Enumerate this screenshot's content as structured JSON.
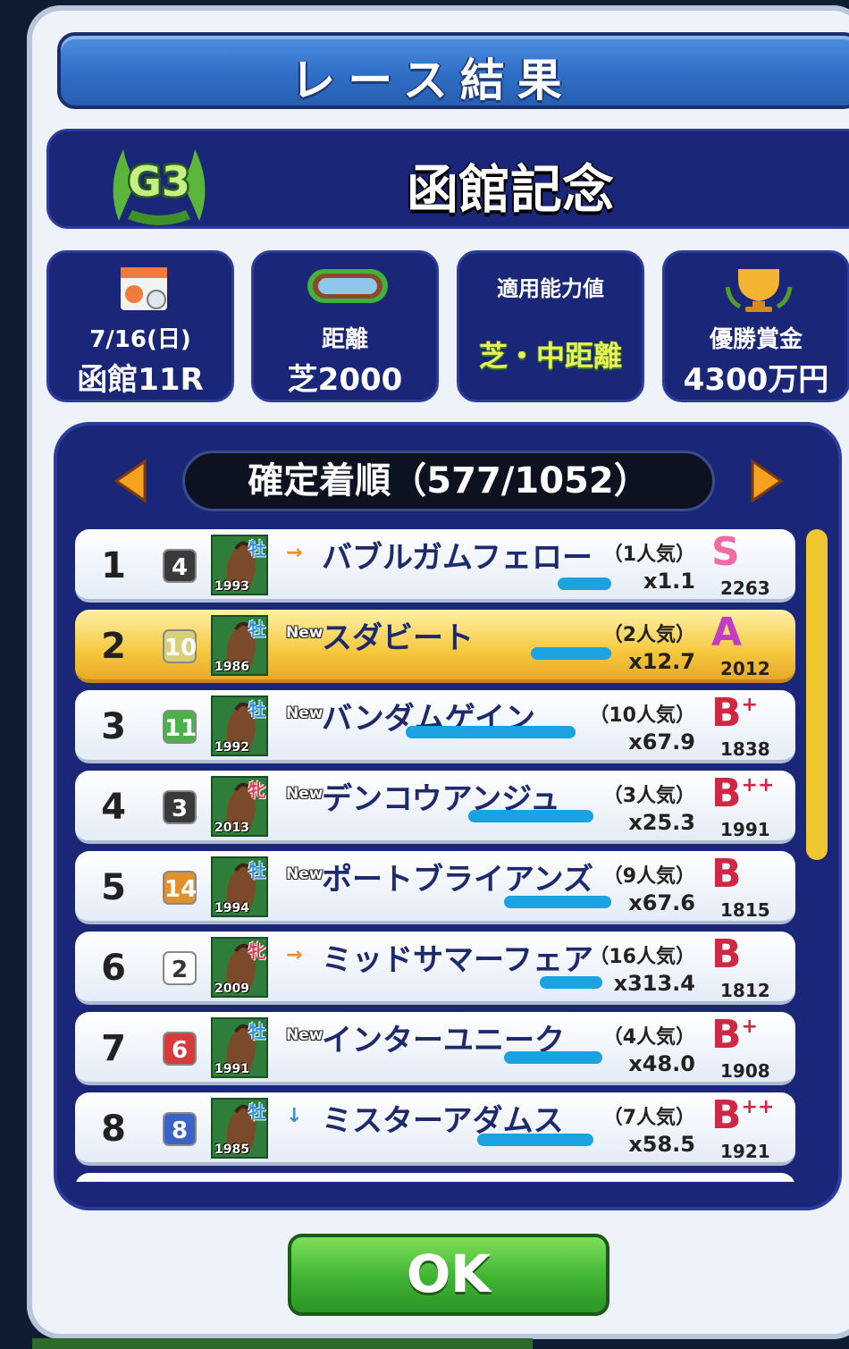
{
  "header": {
    "title": "レース結果"
  },
  "race": {
    "grade": "G3",
    "name": "函館記念"
  },
  "info": {
    "date": "7/16(日)",
    "venue_race": "函館11R",
    "distance_label": "距離",
    "distance_value": "芝2000",
    "ability_label": "適用能力値",
    "ability_value": "芝・中距離",
    "prize_label": "優勝賞金",
    "prize_value": "4300万円"
  },
  "results": {
    "header": "確定着順（577/1052）",
    "rows": [
      {
        "place": "1",
        "gate": "4",
        "sex": "牡",
        "year": "1993",
        "trend": "→",
        "name": "バブルガムフェロー",
        "popularity": "（1人気）",
        "odds": "x1.1",
        "rank": "S",
        "rank_sup": "",
        "score": "2263"
      },
      {
        "place": "2",
        "gate": "10",
        "sex": "牡",
        "year": "1986",
        "trend": "New",
        "name": "スダビート",
        "popularity": "（2人気）",
        "odds": "x12.7",
        "rank": "A",
        "rank_sup": "",
        "score": "2012"
      },
      {
        "place": "3",
        "gate": "11",
        "sex": "牡",
        "year": "1992",
        "trend": "New",
        "name": "バンダムゲイン",
        "popularity": "（10人気）",
        "odds": "x67.9",
        "rank": "B",
        "rank_sup": "+",
        "score": "1838"
      },
      {
        "place": "4",
        "gate": "3",
        "sex": "牝",
        "year": "2013",
        "trend": "New",
        "name": "デンコウアンジュ",
        "popularity": "（3人気）",
        "odds": "x25.3",
        "rank": "B",
        "rank_sup": "++",
        "score": "1991"
      },
      {
        "place": "5",
        "gate": "14",
        "sex": "牡",
        "year": "1994",
        "trend": "New",
        "name": "ポートブライアンズ",
        "popularity": "（9人気）",
        "odds": "x67.6",
        "rank": "B",
        "rank_sup": "",
        "score": "1815"
      },
      {
        "place": "6",
        "gate": "2",
        "sex": "牝",
        "year": "2009",
        "trend": "→",
        "name": "ミッドサマーフェア",
        "popularity": "（16人気）",
        "odds": "x313.4",
        "rank": "B",
        "rank_sup": "",
        "score": "1812"
      },
      {
        "place": "7",
        "gate": "6",
        "sex": "牡",
        "year": "1991",
        "trend": "New",
        "name": "インターユニーク",
        "popularity": "（4人気）",
        "odds": "x48.0",
        "rank": "B",
        "rank_sup": "+",
        "score": "1908"
      },
      {
        "place": "8",
        "gate": "8",
        "sex": "牡",
        "year": "1985",
        "trend": "↓",
        "name": "ミスターアダムス",
        "popularity": "（7人気）",
        "odds": "x58.5",
        "rank": "B",
        "rank_sup": "++",
        "score": "1921"
      }
    ]
  },
  "ok_button": {
    "label": "OK"
  }
}
